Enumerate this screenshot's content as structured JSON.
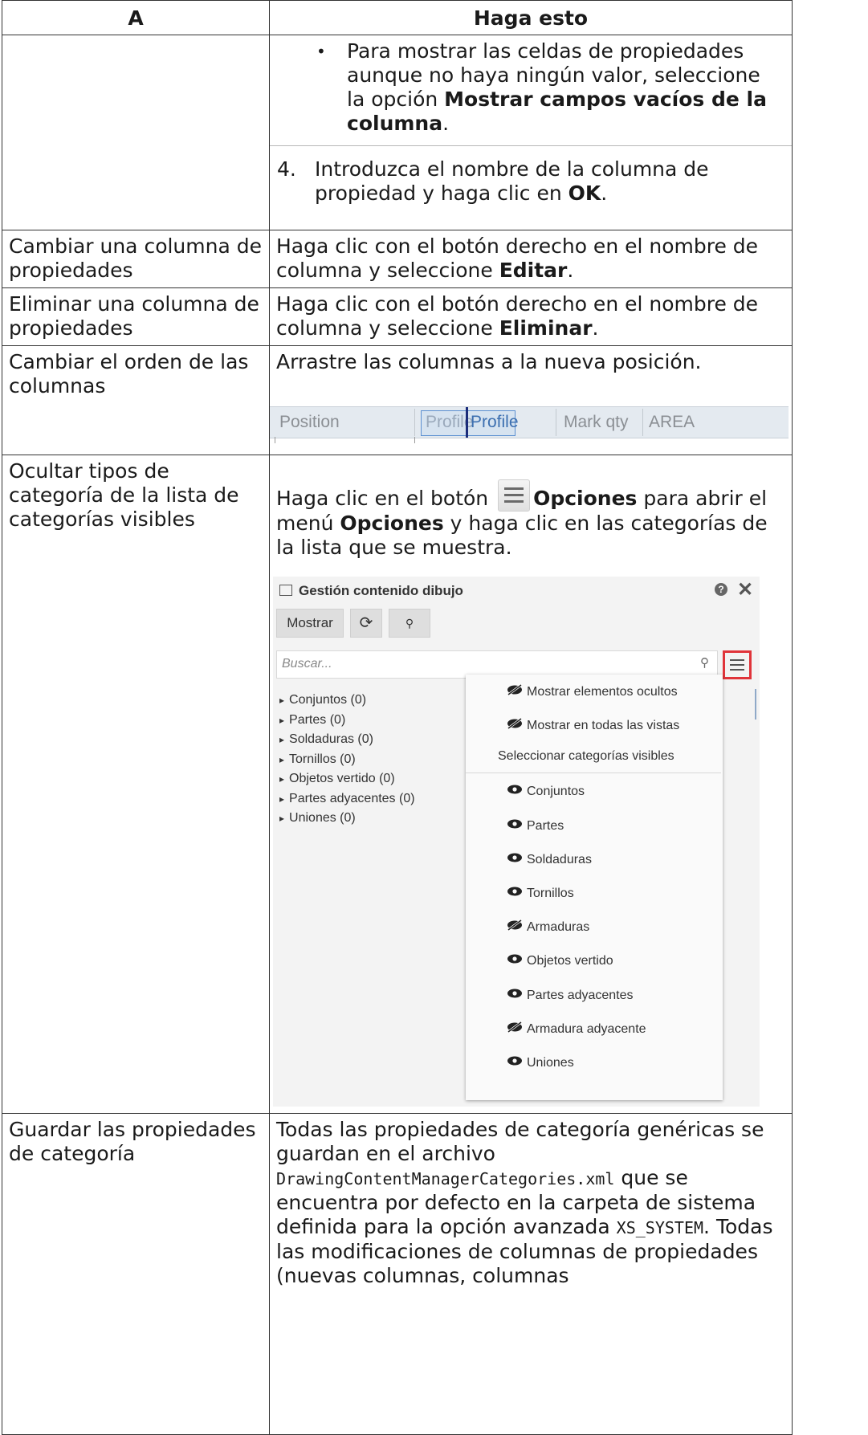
{
  "header": {
    "col_a": "A",
    "col_b": "Haga esto"
  },
  "rows": [
    {
      "a": "",
      "bullet_text_pre": "Para mostrar las celdas de propiedades aunque no haya ningún valor, seleccione la opción ",
      "bullet_bold": "Mostrar campos vacíos de la columna",
      "bullet_text_post": ".",
      "step_num": "4.",
      "step_text_pre": "Introduzca el nombre de la columna de propiedad y haga clic en ",
      "step_bold": "OK",
      "step_text_post": "."
    },
    {
      "a": "Cambiar una columna de propiedades",
      "b_pre": "Haga clic con el botón derecho en el nombre de columna y seleccione ",
      "b_bold": "Editar",
      "b_post": "."
    },
    {
      "a": "Eliminar una columna de propiedades",
      "b_pre": "Haga clic con el botón derecho en el nombre de columna y seleccione ",
      "b_bold": "Eliminar",
      "b_post": "."
    },
    {
      "a": "Cambiar el orden de las columnas",
      "b": "Arrastre las columnas a la nueva posición.",
      "strip": {
        "c1": "Position",
        "ghost": "Profile",
        "c2": "Profile",
        "c3": "Mark qty",
        "c4": "AREA"
      }
    },
    {
      "a": "Ocultar tipos de categoría de la lista de categorías visibles",
      "b_pre": "Haga clic en el botón ",
      "b_bold1": "Opciones",
      "b_mid": " para abrir el menú ",
      "b_bold2": "Opciones",
      "b_post": " y haga clic en las categorías de la lista que se muestra."
    },
    {
      "a": "Guardar las propiedades de categoría",
      "b1": "Todas las propiedades de categoría genéricas se guardan en el archivo",
      "b_file": "DrawingContentManagerCategories.xml",
      "b2": " que se encuentra por defecto en la carpeta de sistema definida para la opción avanzada ",
      "b_opt": "XS_SYSTEM",
      "b3": ". Todas las modificaciones de columnas de propiedades (nuevas columnas, columnas"
    }
  ],
  "panel": {
    "title": "Gestión contenido dibujo",
    "help": "?",
    "close": "✕",
    "btn_show": "Mostrar",
    "btn_refresh": "⟳",
    "btn_select": "⚲",
    "search_placeholder": "Buscar...",
    "tree": [
      "Conjuntos (0)",
      "Partes (0)",
      "Soldaduras (0)",
      "Tornillos (0)",
      "Objetos vertido (0)",
      "Partes adyacentes (0)",
      "Uniones (0)"
    ],
    "menu_top": [
      {
        "label": "Mostrar elementos ocultos",
        "icon": "eye-slash-icon"
      },
      {
        "label": "Mostrar en todas las vistas",
        "icon": "eye-slash-icon"
      }
    ],
    "menu_header": "Seleccionar categorías visibles",
    "categories": [
      {
        "label": "Conjuntos",
        "visible": true
      },
      {
        "label": "Partes",
        "visible": true
      },
      {
        "label": "Soldaduras",
        "visible": true
      },
      {
        "label": "Tornillos",
        "visible": true
      },
      {
        "label": "Armaduras",
        "visible": false
      },
      {
        "label": "Objetos vertido",
        "visible": true
      },
      {
        "label": "Partes adyacentes",
        "visible": true
      },
      {
        "label": "Armadura adyacente",
        "visible": false
      },
      {
        "label": "Uniones",
        "visible": true
      }
    ],
    "colors": {
      "highlight": "#e0343a"
    }
  }
}
